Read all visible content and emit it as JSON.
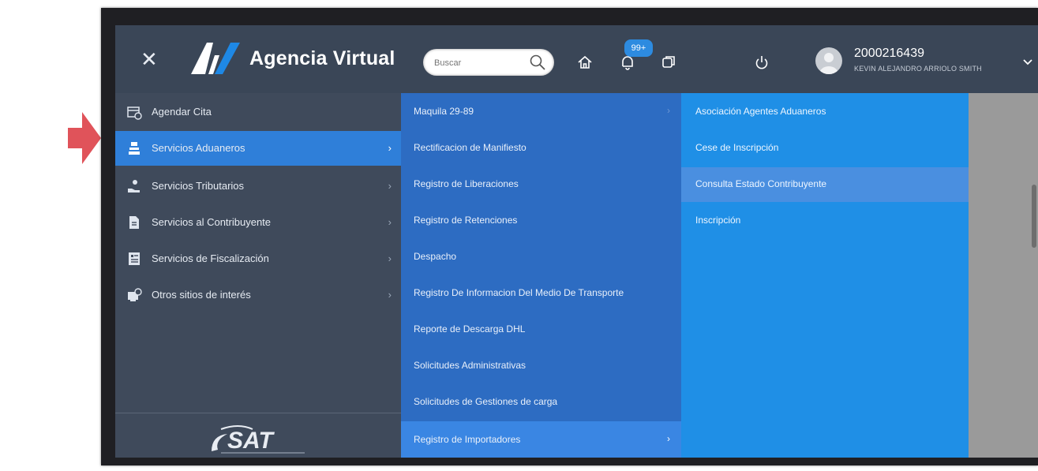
{
  "header": {
    "app_title": "Agencia Virtual",
    "search_placeholder": "Buscar",
    "notification_count": "99+",
    "user_id": "2000216439",
    "user_name": "KEVIN ALEJANDRO ARRIOLO SMITH"
  },
  "sidebar": {
    "items": [
      {
        "label": "Agendar Cita",
        "icon": "calendar-icon",
        "active": false
      },
      {
        "label": "Servicios Aduaneros",
        "icon": "customs-icon",
        "active": true
      },
      {
        "label": "Servicios Tributarios",
        "icon": "hand-coin-icon",
        "active": false
      },
      {
        "label": "Servicios al Contribuyente",
        "icon": "document-icon",
        "active": false
      },
      {
        "label": "Servicios de Fiscalización",
        "icon": "ledger-icon",
        "active": false
      },
      {
        "label": "Otros sitios de interés",
        "icon": "web-icon",
        "active": false
      }
    ],
    "footer_logo": "SAT"
  },
  "submenu": {
    "items": [
      {
        "label": "Maquila 29-89",
        "has_children": true,
        "active": false
      },
      {
        "label": "Rectificacion de Manifiesto",
        "has_children": false,
        "active": false
      },
      {
        "label": "Registro de Liberaciones",
        "has_children": false,
        "active": false
      },
      {
        "label": "Registro de Retenciones",
        "has_children": false,
        "active": false
      },
      {
        "label": "Despacho",
        "has_children": false,
        "active": false
      },
      {
        "label": "Registro De Informacion Del Medio De Transporte",
        "has_children": false,
        "active": false
      },
      {
        "label": "Reporte de Descarga DHL",
        "has_children": false,
        "active": false
      },
      {
        "label": "Solicitudes Administrativas",
        "has_children": false,
        "active": false
      },
      {
        "label": "Solicitudes de Gestiones de carga",
        "has_children": false,
        "active": false
      },
      {
        "label": "Registro de Importadores",
        "has_children": true,
        "active": true
      }
    ]
  },
  "subsubmenu": {
    "items": [
      {
        "label": "Asociación Agentes Aduaneros",
        "active": false
      },
      {
        "label": "Cese de Inscripción",
        "active": false
      },
      {
        "label": "Consulta Estado Contribuyente",
        "active": true
      },
      {
        "label": "Inscripción",
        "active": false
      }
    ]
  },
  "colors": {
    "topbar": "#3a4657",
    "sidebar": "#3f4a5b",
    "sidebar_active": "#2f7fd9",
    "submenu": "#2d6cc2",
    "subsubmenu": "#1f8fe6",
    "arrow": "#e04a4f"
  }
}
